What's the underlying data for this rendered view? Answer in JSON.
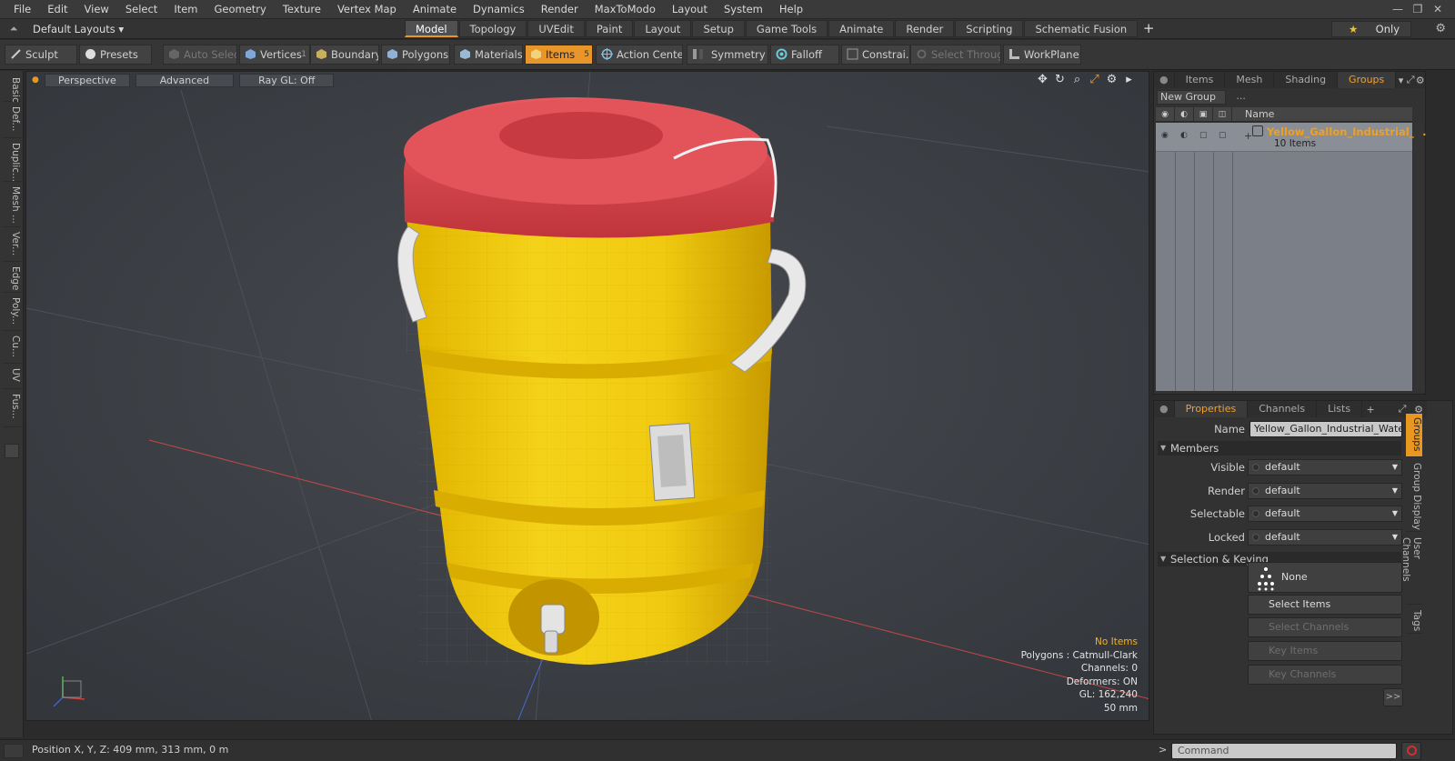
{
  "menu": [
    "File",
    "Edit",
    "View",
    "Select",
    "Item",
    "Geometry",
    "Texture",
    "Vertex Map",
    "Animate",
    "Dynamics",
    "Render",
    "MaxToModo",
    "Layout",
    "System",
    "Help"
  ],
  "layout_selector": "Default Layouts ▾",
  "mode_tabs": [
    "Model",
    "Topology",
    "UVEdit",
    "Paint",
    "Layout",
    "Setup",
    "Game Tools",
    "Animate",
    "Render",
    "Scripting",
    "Schematic Fusion"
  ],
  "only_label": "Only",
  "toolbar": {
    "sculpt": "Sculpt",
    "presets": "Presets",
    "auto_select": "Auto Select",
    "vertices": "Vertices",
    "vertices_count": "1",
    "boundary": "Boundary",
    "polygons": "Polygons",
    "materials": "Materials",
    "items": "Items",
    "items_count": "5",
    "action_center": "Action Center",
    "symmetry": "Symmetry",
    "falloff": "Falloff",
    "constraints": "Constrai...",
    "select_through": "Select Through",
    "workplane": "WorkPlane"
  },
  "left_tabs": [
    "Basic",
    "Def...",
    "Duplic...",
    "Mesh ...",
    "Ver...",
    "Edge",
    "Poly...",
    "Cu...",
    "UV",
    "Fus..."
  ],
  "viewport": {
    "perspective": "Perspective",
    "advanced": "Advanced",
    "raygl": "Ray GL: Off",
    "info": {
      "no_items": "No Items",
      "polygons": "Polygons : Catmull-Clark",
      "channels": "Channels: 0",
      "deformers": "Deformers: ON",
      "gl": "GL: 162,240",
      "scale": "50 mm"
    }
  },
  "groups_panel": {
    "tabs": [
      "Items",
      "Mesh ...",
      "Shading",
      "Groups"
    ],
    "new_group": "New Group",
    "col_name": "Name",
    "group_name": "Yellow_Gallon_Industrial_...",
    "group_count": "10 Items"
  },
  "properties_panel": {
    "tabs": [
      "Properties",
      "Channels",
      "Lists"
    ],
    "name_label": "Name",
    "name_value": "Yellow_Gallon_Industrial_Water_C",
    "members_section": "Members",
    "visible_label": "Visible",
    "visible_value": "default",
    "render_label": "Render",
    "render_value": "default",
    "selectable_label": "Selectable",
    "selectable_value": "default",
    "locked_label": "Locked",
    "locked_value": "default",
    "selkey_section": "Selection & Keying",
    "none_label": "None",
    "select_items": "Select Items",
    "select_channels": "Select Channels",
    "key_items": "Key Items",
    "key_channels": "Key Channels",
    "more": ">>",
    "side_tabs": [
      "Groups",
      "Group Display",
      "User Channels",
      "Tags"
    ]
  },
  "status": {
    "position": "Position X, Y, Z:  409 mm, 313 mm, 0 m",
    "command_placeholder": "Command"
  },
  "colors": {
    "accent": "#e8952a",
    "cooler_yellow": "#f2d010",
    "lid_red": "#d9424a",
    "viewport_bg": "#3c4045"
  }
}
